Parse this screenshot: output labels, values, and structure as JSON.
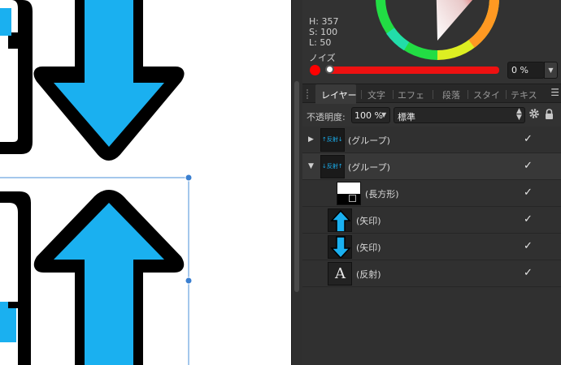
{
  "color": {
    "h_label": "H: 357",
    "s_label": "S: 100",
    "l_label": "L: 50",
    "noise_label": "ノイズ",
    "noise_value": "0 %",
    "noise_fraction": 0,
    "current_color": "#ff0000"
  },
  "tabs": [
    {
      "label": "レイヤー",
      "active": true
    },
    {
      "label": "文字",
      "active": false
    },
    {
      "label": "エフェ",
      "active": false
    },
    {
      "label": "段落",
      "active": false
    },
    {
      "label": "スタイ",
      "active": false
    },
    {
      "label": "テキス",
      "active": false
    }
  ],
  "opacity": {
    "label": "不透明度:",
    "value": "100 %",
    "blend_mode": "標準"
  },
  "layers": [
    {
      "name": "(グループ)",
      "expanded": false,
      "thumb_text": "↑反射↓",
      "check": "✓"
    },
    {
      "name": "(グループ)",
      "expanded": true,
      "thumb_text": "↓反射↑",
      "check": "✓"
    },
    {
      "name": "(長方形)",
      "thumb": "rect",
      "check": "✓"
    },
    {
      "name": "(矢印)",
      "thumb": "arrow-up",
      "check": "✓"
    },
    {
      "name": "(矢印)",
      "thumb": "arrow-down",
      "check": "✓"
    },
    {
      "name": "(反射)",
      "thumb": "text",
      "thumb_text": "A",
      "check": "✓"
    }
  ],
  "accent": "#1ab0f0"
}
